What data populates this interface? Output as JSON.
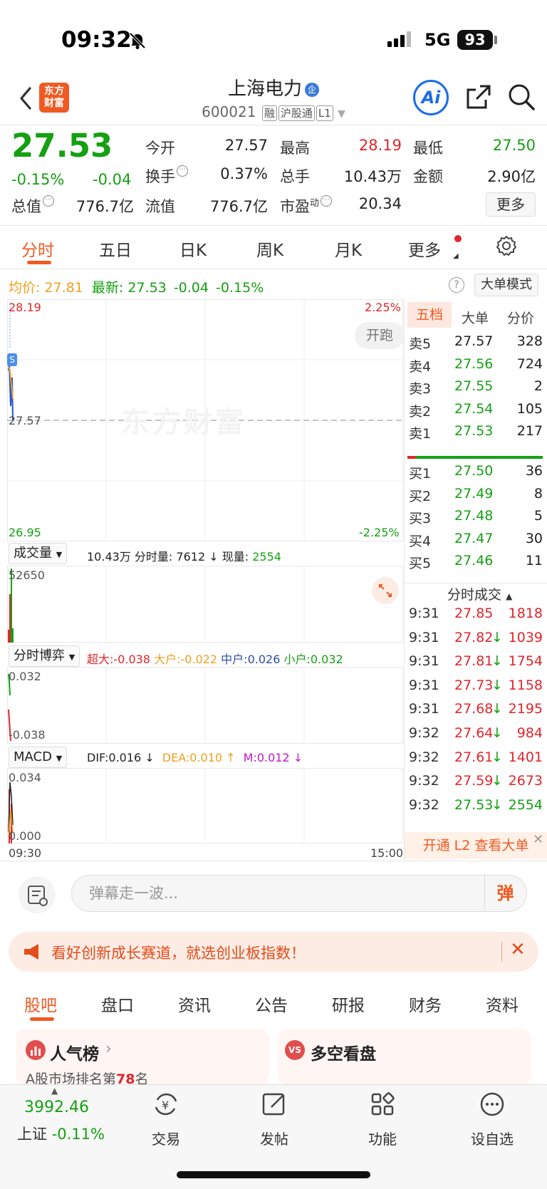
{
  "status": {
    "time": "09:32",
    "network": "5G",
    "battery": "93"
  },
  "header": {
    "logo_line1": "东方",
    "logo_line2": "财富",
    "stock_name": "上海电力",
    "stock_badge": "企",
    "stock_code": "600021",
    "tag1": "融",
    "tag2": "沪股通",
    "tag3": "L1",
    "ai_label": "Ai"
  },
  "quote": {
    "price": "27.53",
    "change_pct": "-0.15%",
    "change": "-0.04",
    "open_label": "今开",
    "open": "27.57",
    "high_label": "最高",
    "high": "28.19",
    "low_label": "最低",
    "low": "27.50",
    "turnover_label": "换手",
    "turnover": "0.37%",
    "volume_label": "总手",
    "volume": "10.43万",
    "amount_label": "金额",
    "amount": "2.90亿",
    "mktcap_label": "总值",
    "mktcap": "776.7亿",
    "float_label": "流值",
    "float": "776.7亿",
    "pe_label": "市盈",
    "pe_sup": "动",
    "pe": "20.34",
    "more": "更多"
  },
  "chart_tabs": [
    "分时",
    "五日",
    "日K",
    "周K",
    "月K",
    "更多"
  ],
  "info_line": {
    "avg_label": "均价:",
    "avg": "27.81",
    "latest_label": "最新:",
    "latest": "27.53",
    "chg": "-0.04",
    "pct": "-0.15%",
    "big_mode": "大单模式"
  },
  "main_chart": {
    "y_max": "28.19",
    "y_mid": "27.57",
    "y_min": "26.95",
    "pct_max": "2.25%",
    "pct_min": "-2.25%",
    "run_btn": "开跑",
    "watermark": "东方财富",
    "marker": "S"
  },
  "volume_panel": {
    "select": "成交量",
    "total": "10.43万",
    "interval_label": "分时量:",
    "interval": "7612",
    "current_label": "现量:",
    "current": "2554",
    "y_max": "52650"
  },
  "game_panel": {
    "select": "分时博弈",
    "xl_label": "超大:",
    "xl": "-0.038",
    "l_label": "大户:",
    "l": "-0.022",
    "m_label": "中户:",
    "m": "0.026",
    "s_label": "小户:",
    "s": "0.032",
    "y_max": "0.032",
    "y_min": "-0.038"
  },
  "macd_panel": {
    "select": "MACD",
    "dif": "DIF:0.016 ↓",
    "dea": "DEA:0.010 ↑",
    "m": "M:0.012 ↓",
    "y_max": "0.034",
    "y_min": "0.000"
  },
  "time_axis": {
    "start": "09:30",
    "end": "15:00"
  },
  "right_tabs": [
    "五档",
    "大单",
    "分价"
  ],
  "asks": [
    {
      "label": "卖5",
      "price": "27.57",
      "vol": "328"
    },
    {
      "label": "卖4",
      "price": "27.56",
      "vol": "724"
    },
    {
      "label": "卖3",
      "price": "27.55",
      "vol": "2"
    },
    {
      "label": "卖2",
      "price": "27.54",
      "vol": "105"
    },
    {
      "label": "卖1",
      "price": "27.53",
      "vol": "217"
    }
  ],
  "bids": [
    {
      "label": "买1",
      "price": "27.50",
      "vol": "36"
    },
    {
      "label": "买2",
      "price": "27.49",
      "vol": "8"
    },
    {
      "label": "买3",
      "price": "27.48",
      "vol": "5"
    },
    {
      "label": "买4",
      "price": "27.47",
      "vol": "30"
    },
    {
      "label": "买5",
      "price": "27.46",
      "vol": "11"
    }
  ],
  "ticks_title": "分时成交",
  "ticks": [
    {
      "time": "9:31",
      "price": "27.85",
      "dir": "",
      "vol": "1818",
      "color": "red"
    },
    {
      "time": "9:31",
      "price": "27.82",
      "dir": "↓",
      "vol": "1039",
      "color": "red"
    },
    {
      "time": "9:31",
      "price": "27.81",
      "dir": "↓",
      "vol": "1754",
      "color": "red"
    },
    {
      "time": "9:31",
      "price": "27.73",
      "dir": "↓",
      "vol": "1158",
      "color": "red"
    },
    {
      "time": "9:31",
      "price": "27.68",
      "dir": "↓",
      "vol": "2195",
      "color": "red"
    },
    {
      "time": "9:32",
      "price": "27.64",
      "dir": "↓",
      "vol": "984",
      "color": "red"
    },
    {
      "time": "9:32",
      "price": "27.61",
      "dir": "↓",
      "vol": "1401",
      "color": "red"
    },
    {
      "time": "9:32",
      "price": "27.59",
      "dir": "↓",
      "vol": "2673",
      "color": "red"
    },
    {
      "time": "9:32",
      "price": "27.53",
      "dir": "↓",
      "vol": "2554",
      "color": "green"
    }
  ],
  "l2_bar": "开通 L2 查看大单",
  "comment": {
    "placeholder": "弹幕走一波...",
    "danmu": "弹"
  },
  "banner": "看好创新成长赛道，就选创业板指数！",
  "bottom_tabs": [
    "股吧",
    "盘口",
    "资讯",
    "公告",
    "研报",
    "财务",
    "资料"
  ],
  "cards": {
    "popular_title": "人气榜",
    "popular_sub_pre": "A股市场排名第",
    "popular_rank": "78",
    "popular_sub_post": "名",
    "longshort_title": "多空看盘",
    "vs_label": "VS"
  },
  "bottom_nav": {
    "index_value": "3992.46",
    "index_name": "上证",
    "index_pct": "-0.11%",
    "trade": "交易",
    "post": "发帖",
    "func": "功能",
    "watch": "设自选"
  },
  "colors": {
    "up": "#e0262b",
    "down": "#15a012",
    "accent": "#f05a22",
    "avg": "#f0a020",
    "ai": "#1a6ce8"
  }
}
